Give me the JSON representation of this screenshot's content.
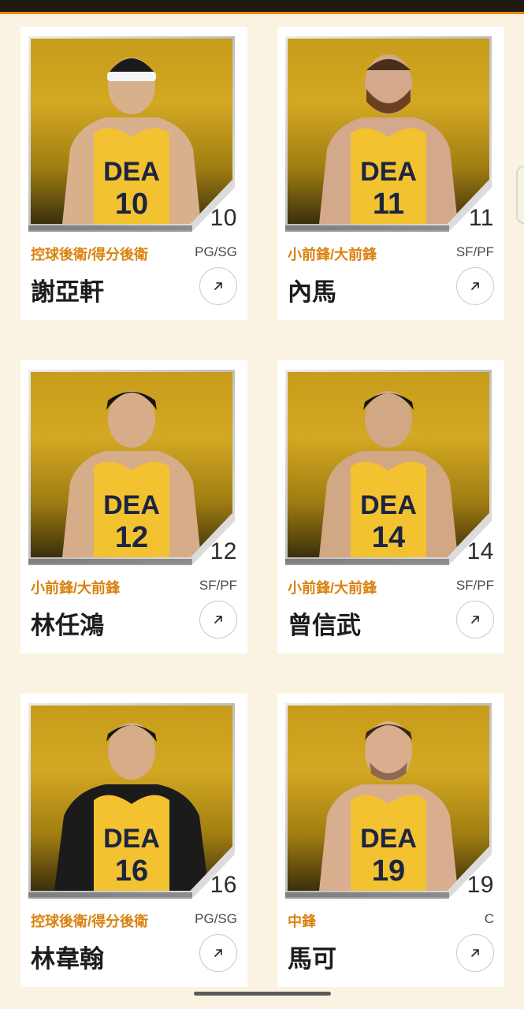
{
  "players": [
    {
      "number": "10",
      "position_zh": "控球後衛/得分後衛",
      "position_en": "PG/SG",
      "name": "謝亞軒",
      "jersey_color": "#f2c230"
    },
    {
      "number": "11",
      "position_zh": "小前鋒/大前鋒",
      "position_en": "SF/PF",
      "name": "內馬",
      "jersey_color": "#f2c230"
    },
    {
      "number": "12",
      "position_zh": "小前鋒/大前鋒",
      "position_en": "SF/PF",
      "name": "林任鴻",
      "jersey_color": "#f2c230"
    },
    {
      "number": "14",
      "position_zh": "小前鋒/大前鋒",
      "position_en": "SF/PF",
      "name": "曾信武",
      "jersey_color": "#f2c230"
    },
    {
      "number": "16",
      "position_zh": "控球後衛/得分後衛",
      "position_en": "PG/SG",
      "name": "林韋翰",
      "jersey_color": "#f2c230"
    },
    {
      "number": "19",
      "position_zh": "中鋒",
      "position_en": "C",
      "name": "馬可",
      "jersey_color": "#f2c230"
    }
  ],
  "jersey_text": "DEA",
  "icons": {
    "link": "arrow-up-right-icon"
  },
  "colors": {
    "accent": "#d9820d",
    "background": "#fbf3e2",
    "topbar": "#1f1a12"
  }
}
